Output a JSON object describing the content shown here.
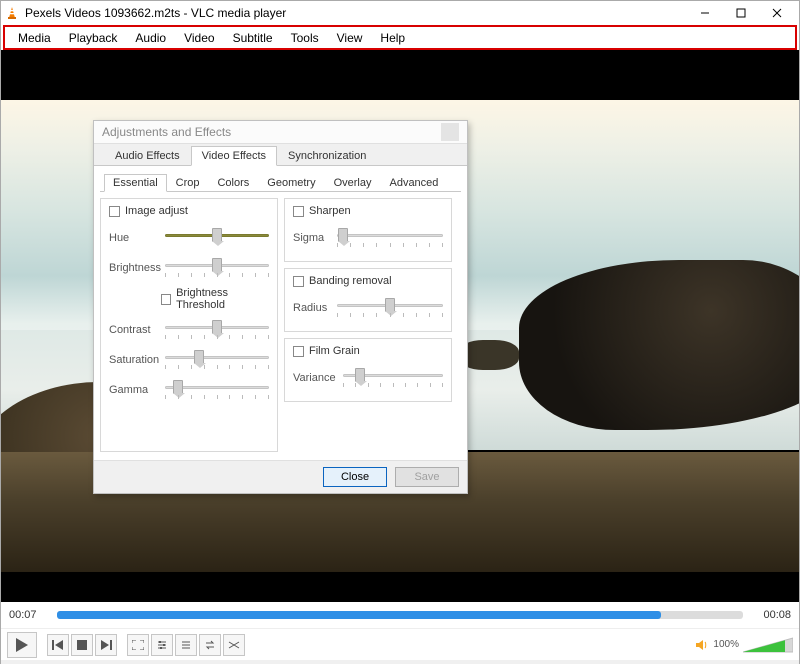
{
  "window": {
    "title": "Pexels Videos 1093662.m2ts - VLC media player"
  },
  "menu": [
    "Media",
    "Playback",
    "Audio",
    "Video",
    "Subtitle",
    "Tools",
    "View",
    "Help"
  ],
  "dialog": {
    "title": "Adjustments and Effects",
    "mainTabs": [
      "Audio Effects",
      "Video Effects",
      "Synchronization"
    ],
    "activeMainTab": 1,
    "subTabs": [
      "Essential",
      "Crop",
      "Colors",
      "Geometry",
      "Overlay",
      "Advanced"
    ],
    "activeSubTab": 0,
    "left": {
      "imageAdjust": "Image adjust",
      "hue": "Hue",
      "brightness": "Brightness",
      "brightnessThreshold": "Brightness Threshold",
      "contrast": "Contrast",
      "saturation": "Saturation",
      "gamma": "Gamma"
    },
    "right": {
      "sharpen": "Sharpen",
      "sigma": "Sigma",
      "banding": "Banding removal",
      "radius": "Radius",
      "filmGrain": "Film Grain",
      "variance": "Variance"
    },
    "closeBtn": "Close",
    "saveBtn": "Save"
  },
  "time": {
    "current": "00:07",
    "total": "00:08"
  },
  "volume": {
    "percent": "100%"
  }
}
